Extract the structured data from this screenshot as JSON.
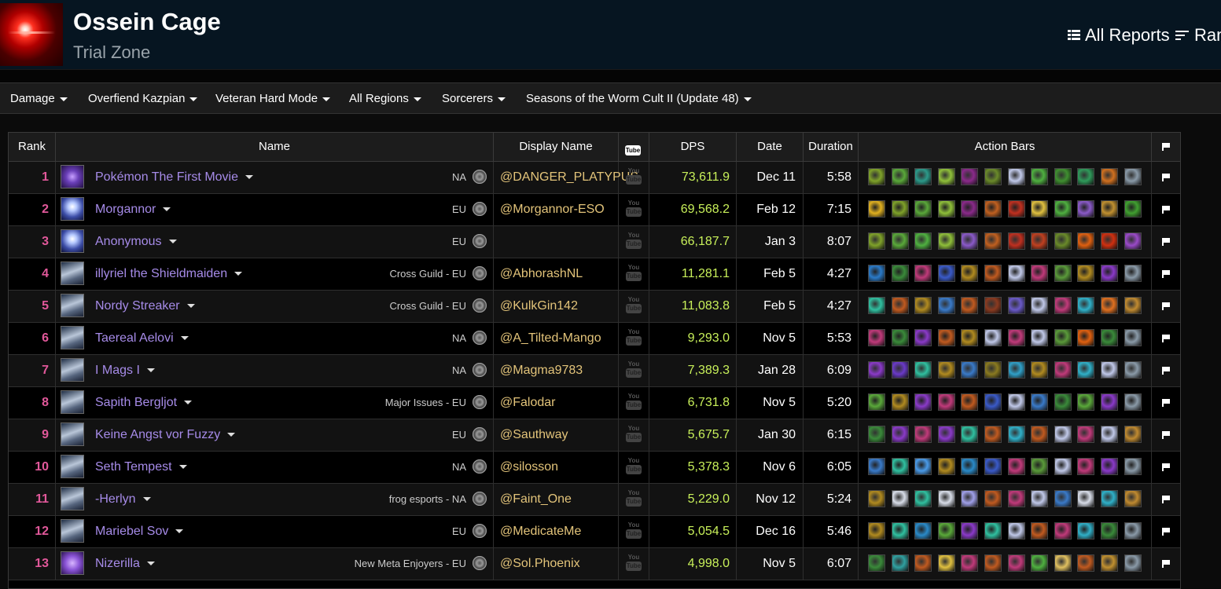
{
  "zone": {
    "title": "Ossein Cage",
    "subtitle": "Trial Zone"
  },
  "top_nav": {
    "all_reports": "All Reports",
    "rankings": "Ran"
  },
  "filters": [
    {
      "label": "Damage"
    },
    {
      "label": "Overfiend Kazpian"
    },
    {
      "label": "Veteran Hard Mode"
    },
    {
      "label": "All Regions"
    },
    {
      "label": "Sorcerers"
    },
    {
      "label": "Seasons of the Worm Cult II (Update 48)"
    }
  ],
  "table": {
    "columns": {
      "rank": "Rank",
      "name": "Name",
      "display_name": "Display Name",
      "yt_top": "You",
      "yt_bottom": "Tube",
      "dps": "DPS",
      "date": "Date",
      "duration": "Duration",
      "action_bars": "Action Bars"
    },
    "rows": [
      {
        "rank": "1",
        "name": "Pokémon The First Movie",
        "guild_region": "NA",
        "display": "@DANGER_PLATYPUS",
        "dps": "73,611.9",
        "date": "Dec 11",
        "duration": "5:58",
        "spec": "purple"
      },
      {
        "rank": "2",
        "name": "Morgannor",
        "guild_region": "EU",
        "display": "@Morgannor-ESO",
        "dps": "69,568.2",
        "date": "Feb 12",
        "duration": "7:15",
        "spec": "light"
      },
      {
        "rank": "3",
        "name": "Anonymous",
        "guild_region": "EU",
        "display": "",
        "dps": "66,187.7",
        "date": "Jan 3",
        "duration": "8:07",
        "spec": "light"
      },
      {
        "rank": "4",
        "name": "illyriel the Shieldmaiden",
        "guild_region": "Cross Guild - EU",
        "display": "@AbhorashNL",
        "dps": "11,281.1",
        "date": "Feb 5",
        "duration": "4:27",
        "spec": "armor"
      },
      {
        "rank": "5",
        "name": "Nordy Streaker",
        "guild_region": "Cross Guild - EU",
        "display": "@KulkGin142",
        "dps": "11,083.8",
        "date": "Feb 5",
        "duration": "4:27",
        "spec": "armor"
      },
      {
        "rank": "6",
        "name": "Taereal Aelovi",
        "guild_region": "NA",
        "display": "@A_Tilted-Mango",
        "dps": "9,293.0",
        "date": "Nov 5",
        "duration": "5:53",
        "spec": "armor"
      },
      {
        "rank": "7",
        "name": "I Mags I",
        "guild_region": "NA",
        "display": "@Magma9783",
        "dps": "7,389.3",
        "date": "Jan 28",
        "duration": "6:09",
        "spec": "armor"
      },
      {
        "rank": "8",
        "name": "Sapith Bergljot",
        "guild_region": "Major Issues - EU",
        "display": "@Falodar",
        "dps": "6,731.8",
        "date": "Nov 5",
        "duration": "5:20",
        "spec": "armor"
      },
      {
        "rank": "9",
        "name": "Keine Angst vor Fuzzy",
        "guild_region": "EU",
        "display": "@Sauthway",
        "dps": "5,675.7",
        "date": "Jan 30",
        "duration": "6:15",
        "spec": "armor"
      },
      {
        "rank": "10",
        "name": "Seth Tempest",
        "guild_region": "NA",
        "display": "@silosson",
        "dps": "5,378.3",
        "date": "Nov 6",
        "duration": "6:05",
        "spec": "armor"
      },
      {
        "rank": "11",
        "name": "-Herlyn",
        "guild_region": "frog esports - NA",
        "display": "@Faint_One",
        "dps": "5,229.0",
        "date": "Nov 12",
        "duration": "5:24",
        "spec": "armor"
      },
      {
        "rank": "12",
        "name": "Mariebel Sov",
        "guild_region": "EU",
        "display": "@MedicateMe",
        "dps": "5,054.5",
        "date": "Dec 16",
        "duration": "5:46",
        "spec": "armor"
      },
      {
        "rank": "13",
        "name": "Nizerilla",
        "guild_region": "New Meta Enjoyers - EU",
        "display": "@Sol.Phoenix",
        "dps": "4,998.0",
        "date": "Nov 5",
        "duration": "6:07",
        "spec": "rune"
      }
    ]
  },
  "colors": {
    "header_bg": "#061521",
    "rank": "#e1589a",
    "player_name": "#a68be8",
    "display_name": "#e3c47a",
    "dps": "#c8f05a"
  },
  "icons": {
    "all_reports": "grid-icon",
    "rankings": "sort-lines-icon",
    "server": "server-swirl-icon",
    "video": "youtube-icon",
    "report_flag": "flag-icon",
    "action_bars": [
      [
        "#7fa22a",
        "#5aa83a",
        "#2c9a8a",
        "#8fbf3a",
        "#8a2a8a",
        "#6a8a2a",
        "#c0c8e8",
        "#4fb040",
        "#3f8f30",
        "#2f9a5a",
        "#d07020",
        "#8a9aa8"
      ],
      [
        "#e0b020",
        "#7fa22a",
        "#5aa83a",
        "#8fbf3a",
        "#8a2a8a",
        "#c06020",
        "#c03020",
        "#e0c040",
        "#4fb040",
        "#8a5ac8",
        "#c09030",
        "#40a030"
      ],
      [
        "#7fa22a",
        "#5aa83a",
        "#4fb040",
        "#8fbf3a",
        "#8a5ac8",
        "#c06020",
        "#c03020",
        "#c04020",
        "#6a8a2a",
        "#e06010",
        "#d03010",
        "#9a4ac8"
      ],
      [
        "#2a7ac8",
        "#3a8a3a",
        "#c03a7a",
        "#3a5ac8",
        "#b08a20",
        "#c05a20",
        "#c0c8e8",
        "#c03a7a",
        "#5a9a3a",
        "#b08a20",
        "#8a3ac8",
        "#8a9aa8"
      ],
      [
        "#30c0a0",
        "#c05a20",
        "#b08a20",
        "#3a7ac8",
        "#c05a20",
        "#8a3a20",
        "#6a5ac8",
        "#c0c8e8",
        "#c03a7a",
        "#30b0c8",
        "#e07020",
        "#c08a30"
      ],
      [
        "#c03a7a",
        "#3a8a3a",
        "#8a3ac8",
        "#c05a20",
        "#b08a20",
        "#c0c8e8",
        "#c03a7a",
        "#c0c8e8",
        "#5a9a3a",
        "#e06010",
        "#3a8a3a",
        "#8a9aa8"
      ],
      [
        "#8a3ac8",
        "#6a3ac8",
        "#30c0a0",
        "#b08a20",
        "#3a7ac8",
        "#8a7a20",
        "#30a0c8",
        "#b08a20",
        "#c03a7a",
        "#30b0c8",
        "#c0c8e8",
        "#8a9aa8"
      ],
      [
        "#5aa83a",
        "#b08a20",
        "#8a3ac8",
        "#c03a7a",
        "#c05a20",
        "#3a5ac8",
        "#c0c8e8",
        "#3a7ac8",
        "#3a8a3a",
        "#5aa83a",
        "#8a3ac8",
        "#8a9aa8"
      ],
      [
        "#3a8a3a",
        "#8a3ac8",
        "#c03a7a",
        "#8a3ac8",
        "#30c0a0",
        "#c05a20",
        "#30b0c8",
        "#c05a20",
        "#c0c8e8",
        "#c03a7a",
        "#c0c8e8",
        "#c08a30"
      ],
      [
        "#3a7ac8",
        "#30c0a0",
        "#4a9ae8",
        "#b08a20",
        "#2a8ac8",
        "#3a5ac8",
        "#c03a7a",
        "#5a9a3a",
        "#c0c8e8",
        "#c03a7a",
        "#8a3ac8",
        "#8a9aa8"
      ],
      [
        "#b08a20",
        "#d8dde8",
        "#30c0a0",
        "#d8dde8",
        "#a0a0e8",
        "#c05a20",
        "#c03a7a",
        "#c0c8e8",
        "#3a7ac8",
        "#d8dde8",
        "#30b0c8",
        "#c08a30"
      ],
      [
        "#b08a20",
        "#30c0a0",
        "#2a8ac8",
        "#5aa83a",
        "#8a3ac8",
        "#30c0a0",
        "#c0c8e8",
        "#c05a20",
        "#c03a7a",
        "#30b0c8",
        "#3a8a3a",
        "#8a9aa8"
      ],
      [
        "#3a8a3a",
        "#30a0a0",
        "#c05a20",
        "#e0c040",
        "#c03a7a",
        "#c05a20",
        "#c03a7a",
        "#4fb040",
        "#e0c060",
        "#c05a20",
        "#c09030",
        "#8a9aa8"
      ]
    ]
  }
}
